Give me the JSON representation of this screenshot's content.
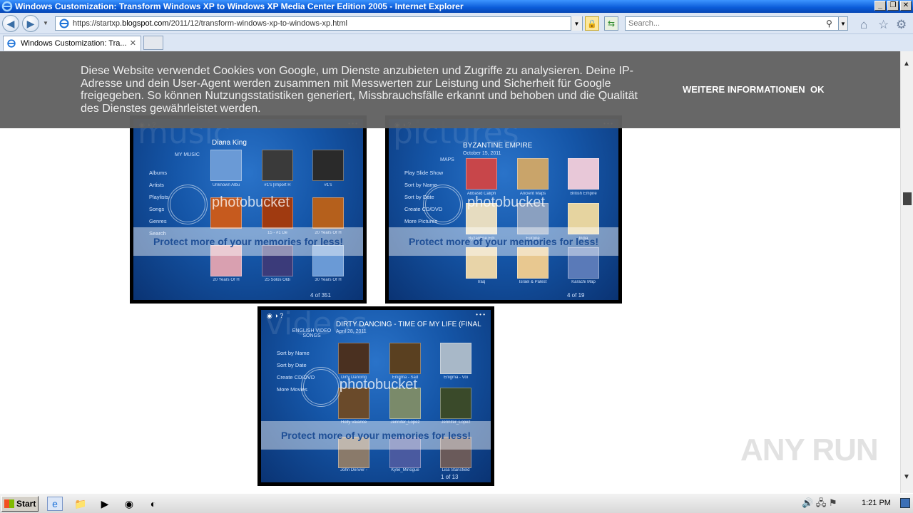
{
  "window": {
    "title": "Windows Customization: Transform Windows XP to Windows XP Media Center Edition 2005 - Internet Explorer",
    "buttons": [
      "_",
      "❐",
      "✕"
    ]
  },
  "address_bar": {
    "url_prefix": "https://startxp.",
    "url_host": "blogspot.com",
    "url_path": "/2011/12/transform-windows-xp-to-windows-xp.html"
  },
  "search": {
    "placeholder": "Search..."
  },
  "tab": {
    "label": "Windows Customization: Tra...",
    "close": "✕"
  },
  "cookie_banner": {
    "message": "Diese Website verwendet Cookies von Google, um Dienste anzubieten und Zugriffe zu analysieren. Deine IP-Adresse und dein User-Agent werden zusammen mit Messwerten zur Leistung und Sicherheit für Google freigegeben. So können Nutzungsstatistiken generiert, Missbrauchsfälle erkannt und behoben und die Qualität des Dienstes gewährleistet werden.",
    "more_info": "WEITERE INFORMATIONEN",
    "ok": "OK"
  },
  "screenshots": {
    "music": {
      "bigword": "music",
      "section": "MY MUSIC",
      "heading": "Diana King",
      "menu": [
        "Albums",
        "Artists",
        "Playlists",
        "Songs",
        "Genres",
        "Search"
      ],
      "captions": [
        "Unknown Albu",
        "#1's [Import R",
        "#1's",
        "",
        "15 - #1 De",
        "20 Years Of H",
        "20 Years Of H",
        "25 Solos Oldi",
        "30 Years Of H"
      ],
      "counter": "4 of 351",
      "watermark": "photobucket",
      "band": "Protect more of your memories for less!"
    },
    "pictures": {
      "bigword": "pictures",
      "section": "MAPS",
      "heading": "BYZANTINE EMPIRE",
      "date": "October 15, 2011",
      "menu": [
        "Play Slide Show",
        "Sort by Name",
        "Sort by Date",
        "Create CD/DVD",
        "More Pictures"
      ],
      "captions": [
        "Abbasid Caliph",
        "Ancient Maps",
        "British Empire",
        "Byzantine Em",
        "Europe",
        "India",
        "Iraq",
        "Israel & Palest",
        "Karachi Map"
      ],
      "counter": "4 of 19",
      "watermark": "photobucket",
      "band": "Protect more of your memories for less!"
    },
    "videos": {
      "bigword": "videos",
      "section": "ENGLISH VIDEO SONGS",
      "heading": "DIRTY DANCING - TIME OF MY LIFE (FINAL",
      "date": "April 28, 2011",
      "menu": [
        "Sort by Name",
        "Sort by Date",
        "Create CD/DVD",
        "More Movies"
      ],
      "captions": [
        "Dirty Dancing",
        "Enigma - Sad",
        "Enigma - Voi",
        "Holly Valance",
        "Jennifer_Lopez",
        "Jennifer_Lopez",
        "John Denver -",
        "Kylie_Minogue",
        "Lisa Stansfield"
      ],
      "counter": "1 of 13",
      "watermark": "photobucket",
      "band": "Protect more of your memories for less!"
    }
  },
  "watermark": {
    "text": "ANY RUN"
  },
  "taskbar": {
    "start": "Start",
    "clock": "1:21 PM"
  },
  "colors": {
    "titlebar": "#0a5bd8",
    "cookie_bg": "#616161",
    "screen_blue": "#1556a8"
  }
}
